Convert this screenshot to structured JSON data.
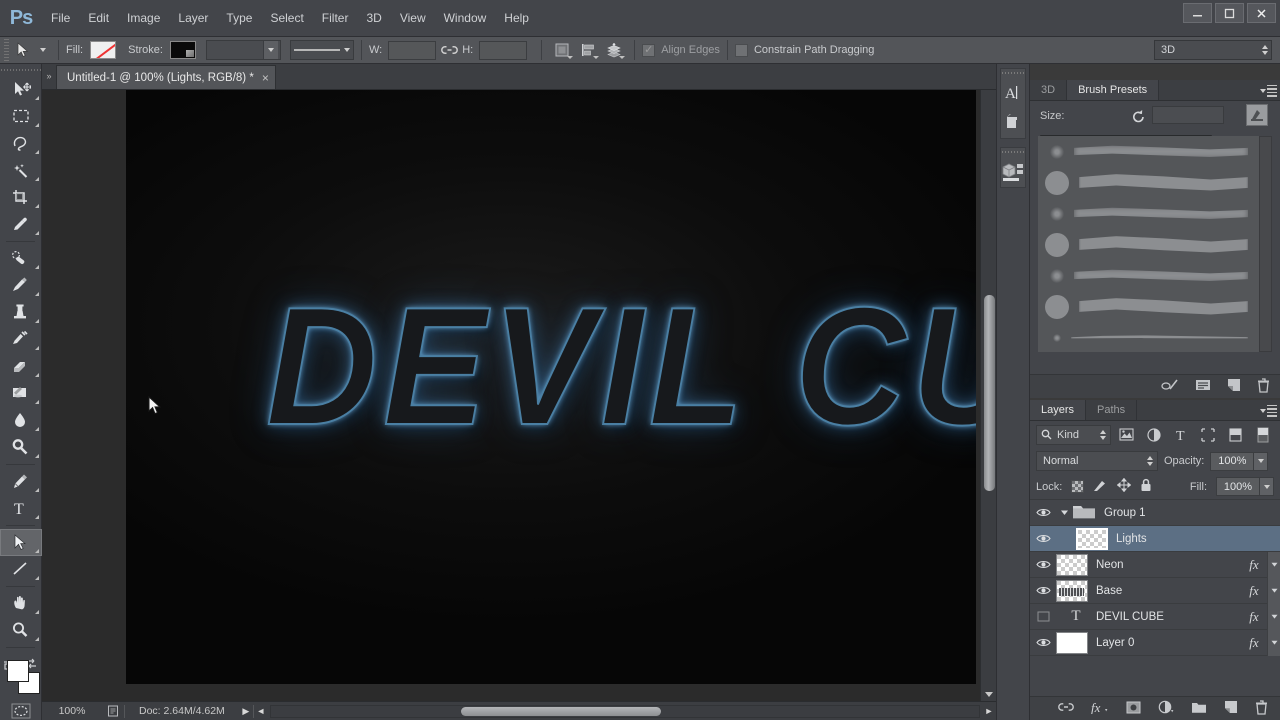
{
  "app": {
    "logo": "Ps",
    "menus": [
      "File",
      "Edit",
      "Image",
      "Layer",
      "Type",
      "Select",
      "Filter",
      "3D",
      "View",
      "Window",
      "Help"
    ],
    "window_controls": {
      "minimize": "—",
      "maximize": "❐",
      "close": "✕"
    }
  },
  "options_bar": {
    "fill_label": "Fill:",
    "stroke_label": "Stroke:",
    "width_label": "W:",
    "height_label": "H:",
    "width_value": "",
    "height_value": "",
    "align_edges_label": "Align Edges",
    "align_edges_checked": true,
    "constrain_path_label": "Constrain Path Dragging",
    "constrain_path_checked": false,
    "workspace_value": "3D",
    "fill_swatch": "#ffffff",
    "stroke_swatch": "#000000"
  },
  "toolbar": {
    "tools": [
      {
        "name": "move-tool",
        "selected": false
      },
      {
        "name": "rectangular-marquee-tool",
        "selected": false
      },
      {
        "name": "lasso-tool",
        "selected": false
      },
      {
        "name": "magic-wand-tool",
        "selected": false
      },
      {
        "name": "crop-tool",
        "selected": false
      },
      {
        "name": "eyedropper-tool",
        "selected": false
      },
      {
        "name": "spot-healing-brush-tool",
        "selected": false
      },
      {
        "name": "brush-tool",
        "selected": false
      },
      {
        "name": "clone-stamp-tool",
        "selected": false
      },
      {
        "name": "history-brush-tool",
        "selected": false
      },
      {
        "name": "eraser-tool",
        "selected": false
      },
      {
        "name": "gradient-tool",
        "selected": false
      },
      {
        "name": "blur-tool",
        "selected": false
      },
      {
        "name": "dodge-tool",
        "selected": false
      },
      {
        "name": "pen-tool",
        "selected": false
      },
      {
        "name": "type-tool",
        "selected": false
      },
      {
        "name": "path-selection-tool",
        "selected": true
      },
      {
        "name": "line-tool",
        "selected": false
      },
      {
        "name": "hand-tool",
        "selected": false
      },
      {
        "name": "zoom-tool",
        "selected": false
      }
    ],
    "foreground_color": "#ffffff",
    "background_color": "#ffffff"
  },
  "document": {
    "tab_title": "Untitled-1 @ 100% (Lights, RGB/8) *",
    "close_label": "×",
    "canvas_text": "DEVIL CU",
    "neon_color": "#5a93bd",
    "background_color": "#060606"
  },
  "status_bar": {
    "zoom": "100%",
    "doc_info": "Doc: 2.64M/4.62M",
    "play_arrow": "▶",
    "left_arrow": "◄",
    "right_arrow": "►"
  },
  "mini_dock": {
    "items": [
      {
        "name": "character-panel-icon",
        "glyph": "A"
      },
      {
        "name": "paragraph-panel-icon",
        "glyph": "¶"
      },
      {
        "name": "3d-panel-icon",
        "glyph": ""
      }
    ]
  },
  "brush_panel": {
    "tabs": [
      {
        "label": "3D",
        "active": false
      },
      {
        "label": "Brush Presets",
        "active": true
      }
    ],
    "size_label": "Size:",
    "size_value": "",
    "presets": [
      {
        "name": "soft-round-30",
        "dot": 14,
        "soft": true,
        "stroke_h": 13,
        "blur": 3
      },
      {
        "name": "soft-round-45",
        "dot": 24,
        "soft": false,
        "stroke_h": 19,
        "blur": 1
      },
      {
        "name": "soft-round-30b",
        "dot": 14,
        "soft": true,
        "stroke_h": 13,
        "blur": 3
      },
      {
        "name": "soft-round-45b",
        "dot": 24,
        "soft": false,
        "stroke_h": 19,
        "blur": 1
      },
      {
        "name": "soft-round-30c",
        "dot": 14,
        "soft": true,
        "stroke_h": 13,
        "blur": 3
      },
      {
        "name": "soft-round-45c",
        "dot": 24,
        "soft": false,
        "stroke_h": 19,
        "blur": 1
      },
      {
        "name": "flat-fan-brush",
        "dot": 8,
        "soft": true,
        "stroke_h": 7,
        "blur": 1
      }
    ],
    "footer_icons": [
      "toggle-brush-panel-icon",
      "brush-preset-view-icon",
      "new-brush-icon",
      "delete-brush-icon"
    ]
  },
  "layers_panel": {
    "tabs": [
      {
        "label": "Layers",
        "active": true
      },
      {
        "label": "Paths",
        "active": false
      }
    ],
    "filter_label": "Kind",
    "filter_icons": [
      "pixel-filter-icon",
      "adjustment-filter-icon",
      "type-filter-icon",
      "shape-filter-icon",
      "smartobject-filter-icon"
    ],
    "blend_mode": "Normal",
    "opacity_label": "Opacity:",
    "opacity_value": "100%",
    "lock_label": "Lock:",
    "fill_label": "Fill:",
    "fill_value": "100%",
    "layers": [
      {
        "name": "Group 1",
        "type": "group",
        "visible": true,
        "selected": false,
        "fx": false,
        "thumb": "none",
        "expanded": true,
        "indent": 0
      },
      {
        "name": "Lights",
        "type": "pixel",
        "visible": true,
        "selected": true,
        "fx": false,
        "thumb": "empty",
        "expanded": false,
        "indent": 1
      },
      {
        "name": "Neon",
        "type": "pixel",
        "visible": true,
        "selected": false,
        "fx": true,
        "thumb": "empty",
        "expanded": false,
        "indent": 0
      },
      {
        "name": "Base",
        "type": "pixel",
        "visible": true,
        "selected": false,
        "fx": true,
        "thumb": "text",
        "expanded": false,
        "indent": 0
      },
      {
        "name": "DEVIL CUBE",
        "type": "text",
        "visible": false,
        "selected": false,
        "fx": true,
        "thumb": "type",
        "expanded": false,
        "indent": 0
      },
      {
        "name": "Layer 0",
        "type": "pixel",
        "visible": true,
        "selected": false,
        "fx": true,
        "thumb": "white",
        "expanded": false,
        "indent": 0
      }
    ],
    "footer_icons": [
      "link-layers-icon",
      "layer-style-fx-icon",
      "add-mask-icon",
      "adjustment-layer-icon",
      "new-group-icon",
      "new-layer-icon",
      "delete-layer-icon"
    ]
  }
}
